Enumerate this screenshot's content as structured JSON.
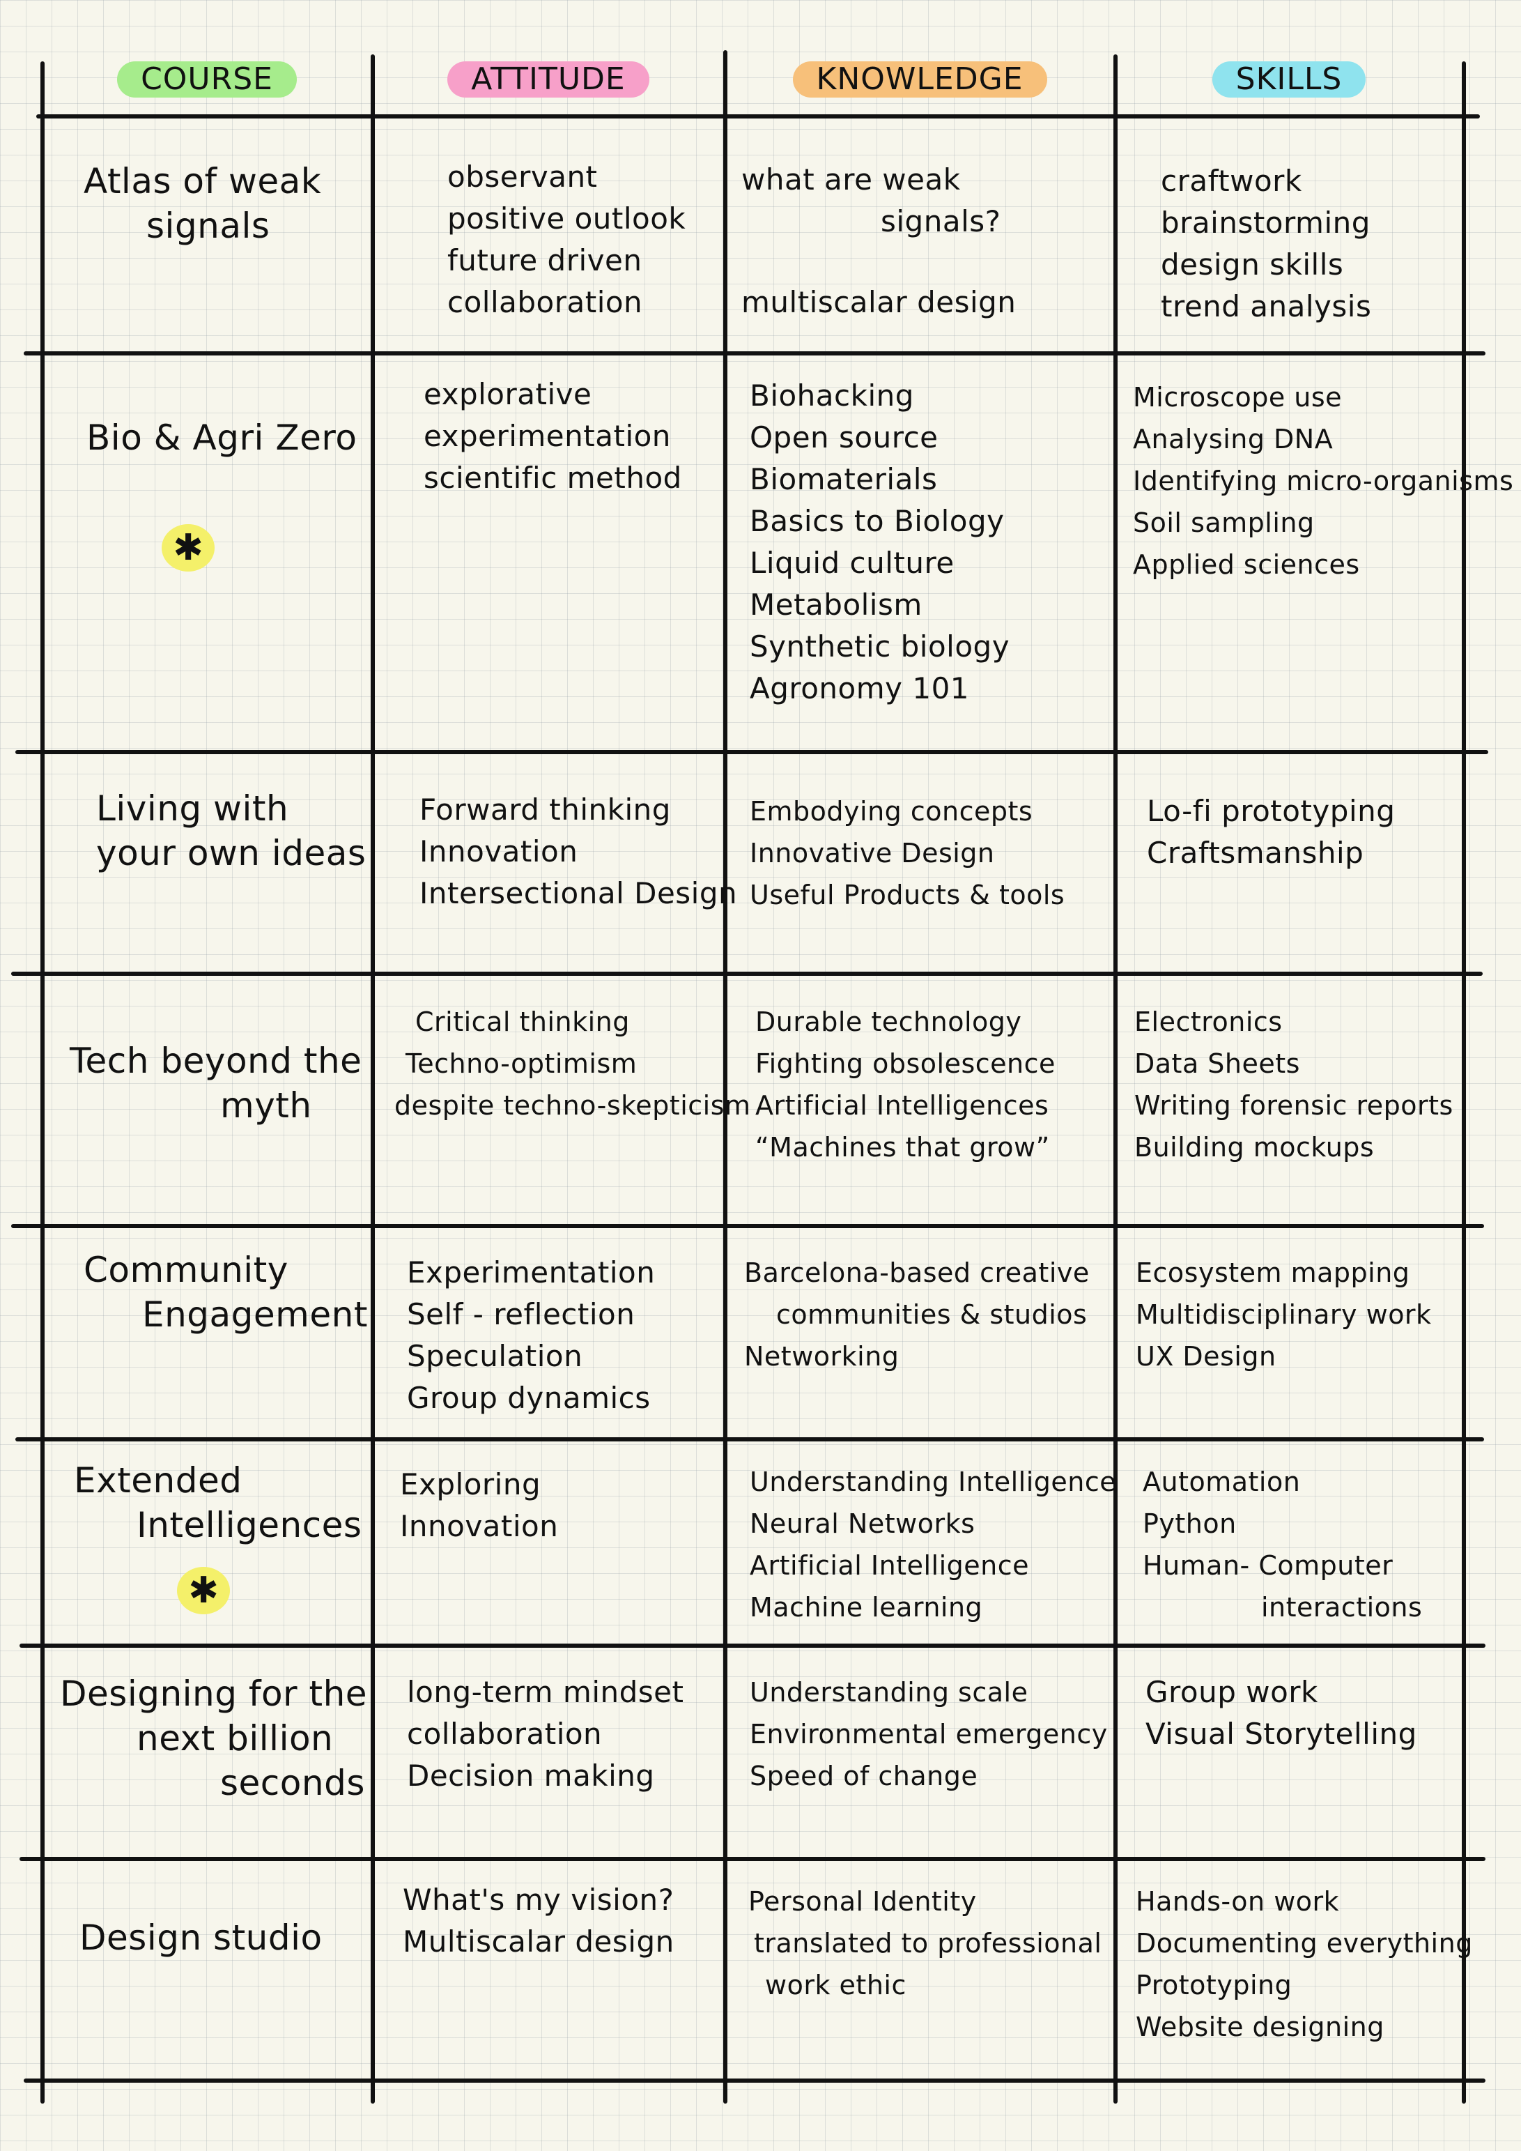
{
  "header": {
    "course": "COURSE",
    "attitude": "ATTITUDE",
    "knowledge": "KNOWLEDGE",
    "skills": "SKILLS"
  },
  "colors": {
    "course": "#a6ec8c",
    "attitude": "#f7a0c9",
    "knowledge": "#f7c07a",
    "skills": "#8fe3ee",
    "star_highlight": "#f4f06a",
    "ink": "#111111"
  },
  "rows": [
    {
      "course": [
        "Atlas of weak",
        "signals"
      ],
      "attitude": [
        "observant",
        "positive outlook",
        "future driven",
        "collaboration"
      ],
      "knowledge": [
        "what are weak",
        "signals?",
        "",
        "multiscalar design"
      ],
      "skills": [
        "craftwork",
        "brainstorming",
        "design skills",
        "trend analysis"
      ],
      "star": false
    },
    {
      "course": [
        "Bio & Agri Zero"
      ],
      "attitude": [
        "explorative",
        "experimentation",
        "scientific method"
      ],
      "knowledge": [
        "Biohacking",
        "Open source",
        "Biomaterials",
        "Basics to Biology",
        "Liquid culture",
        "Metabolism",
        "Synthetic biology",
        "Agronomy 101"
      ],
      "skills": [
        "Microscope use",
        "Analysing DNA",
        "Identifying micro-organisms",
        "Soil sampling",
        "Applied sciences"
      ],
      "star": true,
      "star_icon": "star-icon"
    },
    {
      "course": [
        "Living with",
        "your own ideas"
      ],
      "attitude": [
        "Forward thinking",
        "Innovation",
        "Intersectional Design"
      ],
      "knowledge": [
        "Embodying concepts",
        "Innovative Design",
        "Useful Products & tools"
      ],
      "skills": [
        "Lo-fi prototyping",
        "Craftsmanship"
      ],
      "star": false
    },
    {
      "course": [
        "Tech beyond the",
        "myth"
      ],
      "attitude": [
        "Critical thinking",
        "Techno-optimism",
        "despite techno-skepticism"
      ],
      "knowledge": [
        "Durable technology",
        "Fighting obsolescence",
        "Artificial Intelligences",
        "“Machines that grow”"
      ],
      "skills": [
        "Electronics",
        "Data Sheets",
        "Writing forensic reports",
        "Building mockups"
      ],
      "star": false
    },
    {
      "course": [
        "Community",
        "Engagement"
      ],
      "attitude": [
        "Experimentation",
        "Self - reflection",
        "Speculation",
        "Group dynamics"
      ],
      "knowledge": [
        "Barcelona-based creative",
        "communities & studios",
        "Networking"
      ],
      "skills": [
        "Ecosystem mapping",
        "Multidisciplinary work",
        "UX Design"
      ],
      "star": false
    },
    {
      "course": [
        "Extended",
        "Intelligences"
      ],
      "attitude": [
        "Exploring",
        "Innovation"
      ],
      "knowledge": [
        "Understanding Intelligence",
        "Neural Networks",
        "Artificial Intelligence",
        "Machine learning"
      ],
      "skills": [
        "Automation",
        "Python",
        "Human- Computer",
        "interactions"
      ],
      "star": true,
      "star_icon": "star-icon"
    },
    {
      "course": [
        "Designing for the",
        "next billion",
        "seconds"
      ],
      "attitude": [
        "long-term mindset",
        "collaboration",
        "Decision making"
      ],
      "knowledge": [
        "Understanding scale",
        "Environmental emergency",
        "Speed of change"
      ],
      "skills": [
        "Group work",
        "Visual Storytelling"
      ],
      "star": false
    },
    {
      "course": [
        "Design studio"
      ],
      "attitude": [
        "What's my vision?",
        "Multiscalar design"
      ],
      "knowledge": [
        "Personal Identity",
        "translated to professional",
        "work ethic"
      ],
      "skills": [
        "Hands-on work",
        "Documenting everything",
        "Prototyping",
        "Website designing"
      ],
      "star": false
    }
  ]
}
